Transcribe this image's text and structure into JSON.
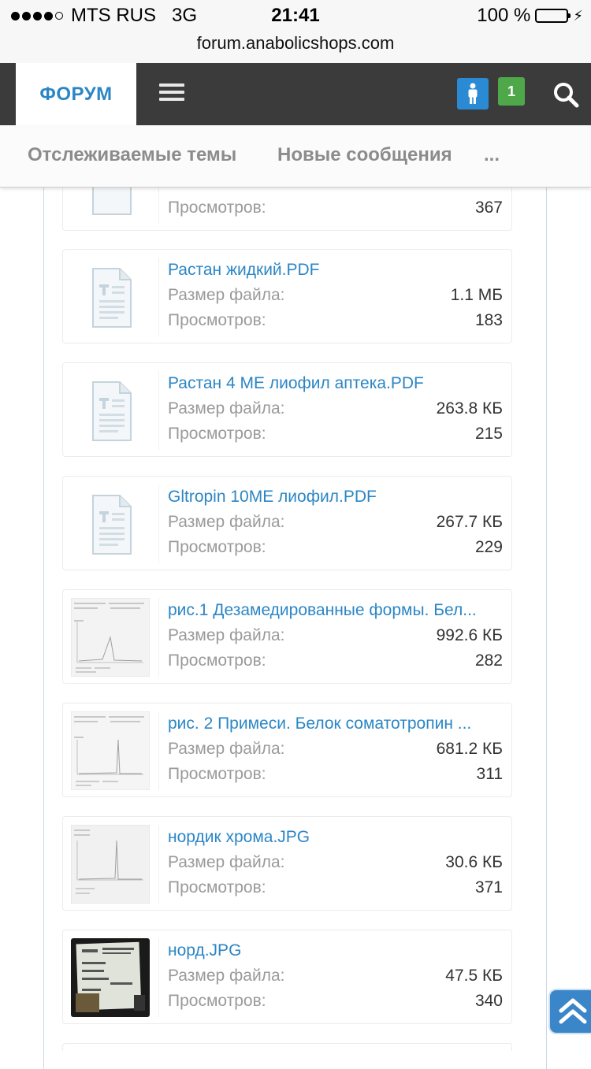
{
  "status_bar": {
    "carrier": "MTS RUS",
    "network": "3G",
    "time": "21:41",
    "battery": "100 %"
  },
  "url": "forum.anabolicshops.com",
  "nav": {
    "forum_label": "ФОРУМ",
    "alerts_count": "1"
  },
  "tabs": [
    {
      "label": "Отслеживаемые темы"
    },
    {
      "label": "Новые сообщения"
    },
    {
      "label": "..."
    }
  ],
  "attachments_labels": {
    "size": "Размер файла:",
    "views": "Просмотров:"
  },
  "attachments": [
    {
      "name": "",
      "size": "",
      "views": "367",
      "thumb": "pdf-file-icon"
    },
    {
      "name": "Растан жидкий.PDF",
      "size": "1.1 МБ",
      "views": "183",
      "thumb": "pdf-file-icon"
    },
    {
      "name": "Растан 4 МЕ лиофил аптека.PDF",
      "size": "263.8 КБ",
      "views": "215",
      "thumb": "pdf-file-icon"
    },
    {
      "name": "Gltropin 10МЕ лиофил.PDF",
      "size": "267.7 КБ",
      "views": "229",
      "thumb": "pdf-file-icon"
    },
    {
      "name": "рис.1 Дезамедированные формы. Бел...",
      "size": "992.6 КБ",
      "views": "282",
      "thumb": "chart-image-thumbnail"
    },
    {
      "name": "рис. 2 Примеси. Белок соматотропин ...",
      "size": "681.2 КБ",
      "views": "311",
      "thumb": "chart-image-thumbnail"
    },
    {
      "name": "нордик хрома.JPG",
      "size": "30.6 КБ",
      "views": "371",
      "thumb": "chart-image-thumbnail"
    },
    {
      "name": "норд.JPG",
      "size": "47.5 КБ",
      "views": "340",
      "thumb": "photo-thumbnail"
    }
  ],
  "colors": {
    "accent": "#2b86c5",
    "navbar": "#3b3b3b",
    "alert": "#4ea84a",
    "battery": "#f6c300"
  }
}
